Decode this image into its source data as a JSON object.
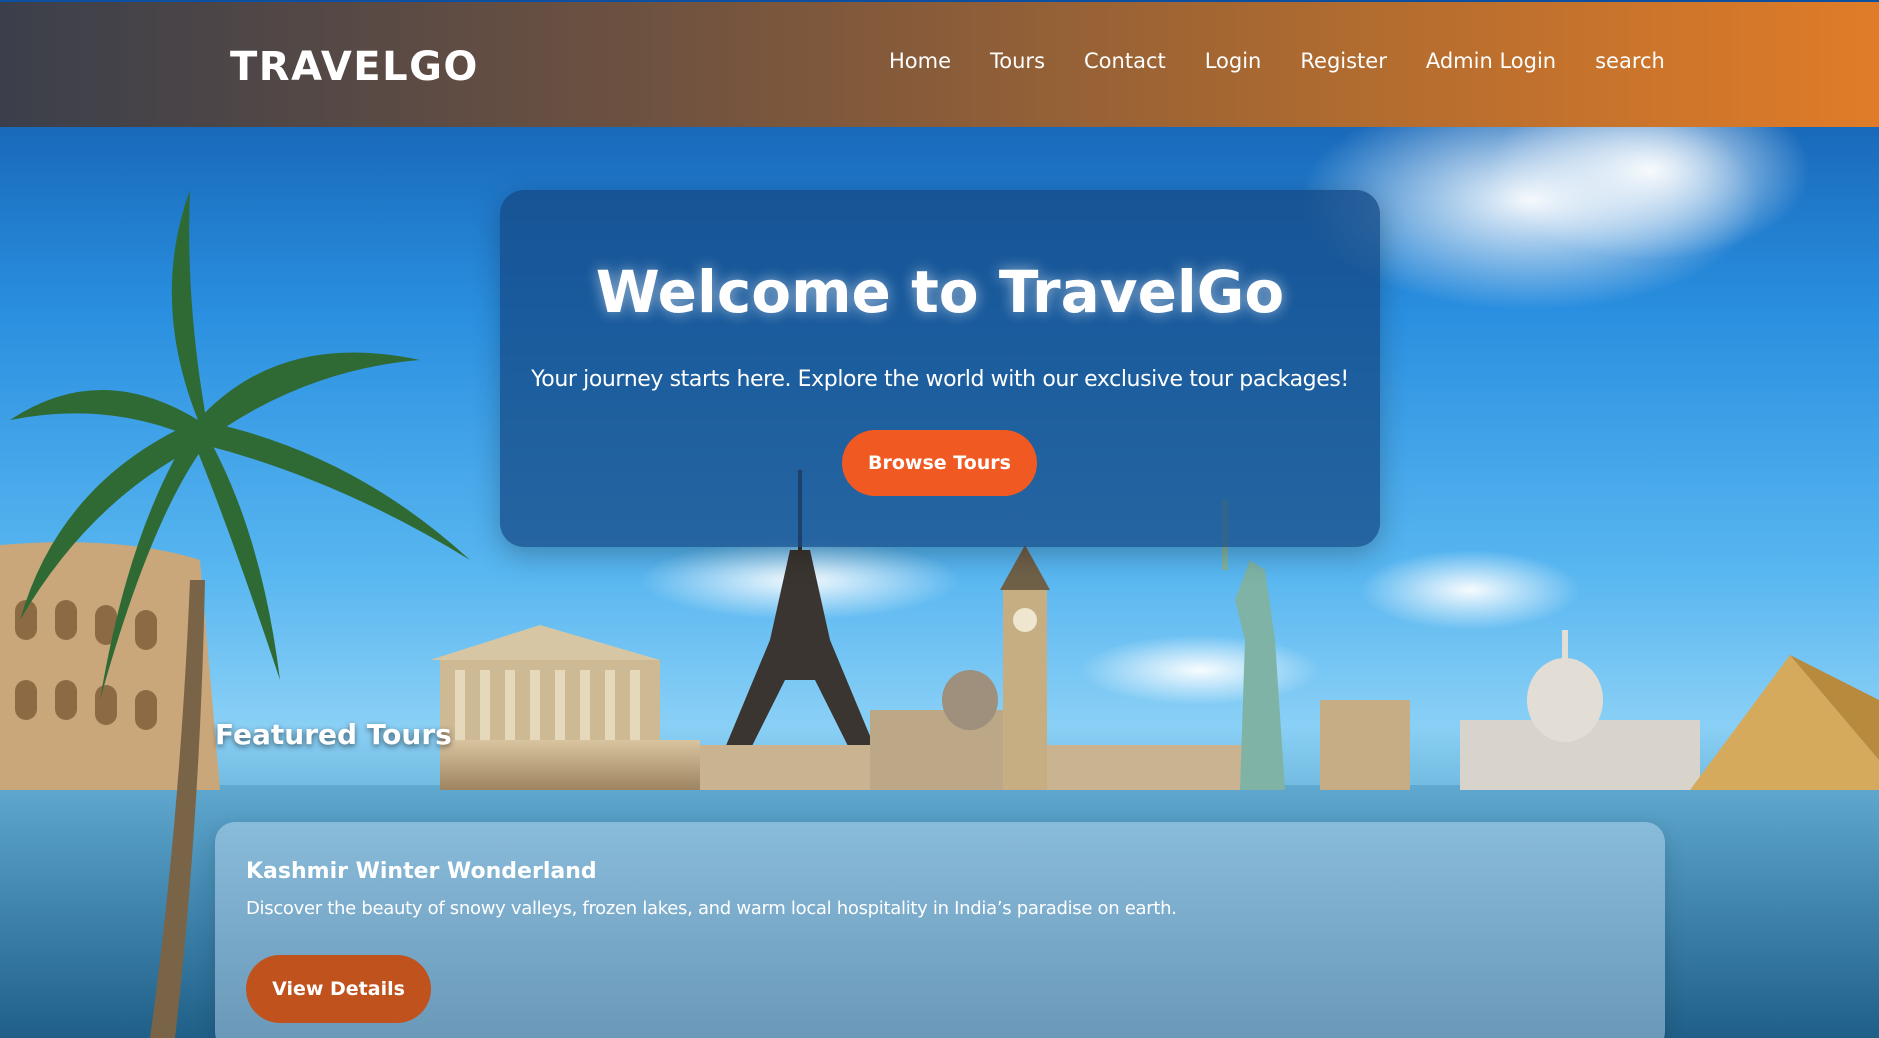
{
  "header": {
    "logo": "TRAVELGO",
    "nav": [
      "Home",
      "Tours",
      "Contact",
      "Login",
      "Register",
      "Admin Login",
      "search"
    ]
  },
  "hero": {
    "title": "Welcome to TravelGo",
    "subtitle": "Your journey starts here. Explore the world with our exclusive tour packages!",
    "button": "Browse Tours"
  },
  "featured": {
    "heading": "Featured Tours",
    "tours": [
      {
        "title": "Kashmir Winter Wonderland",
        "description": "Discover the beauty of snowy valleys, frozen lakes, and warm local hospitality in India’s paradise on earth.",
        "button": "View Details"
      }
    ]
  },
  "colors": {
    "header_start": "#3b3f4b",
    "header_end": "#e07c28",
    "primary_button": "#f05a22",
    "secondary_button": "#c0521e"
  }
}
